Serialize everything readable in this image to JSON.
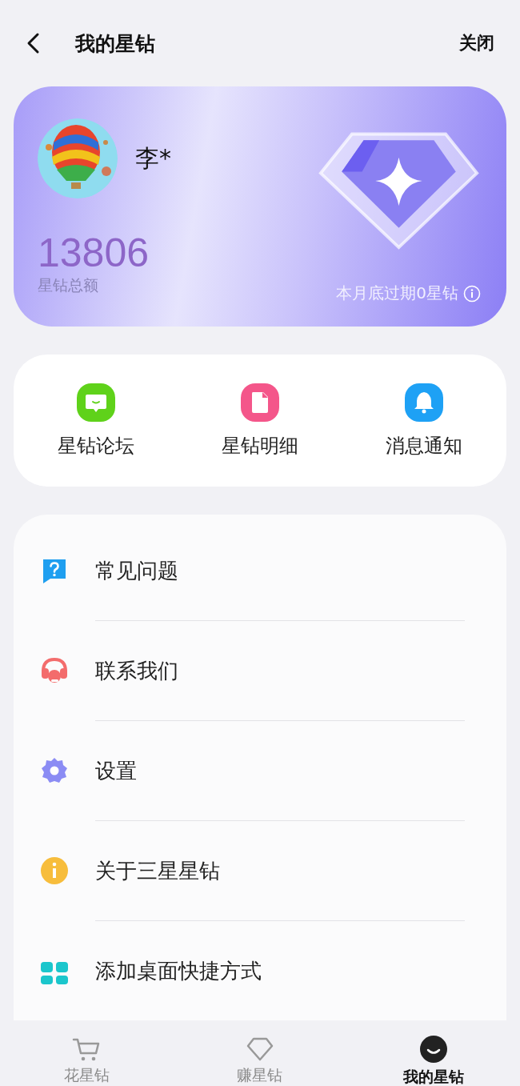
{
  "header": {
    "title": "我的星钻",
    "close": "关闭"
  },
  "balance_card": {
    "name": "李*",
    "amount": "13806",
    "amount_label": "星钻总额",
    "expiry_note": "本月底过期0星钻"
  },
  "quick_actions": [
    {
      "label": "星钻论坛",
      "kind": "forum",
      "color": "#5fd21a"
    },
    {
      "label": "星钻明细",
      "kind": "details",
      "color": "#f4568a"
    },
    {
      "label": "消息通知",
      "kind": "notice",
      "color": "#1ea1f5"
    }
  ],
  "menu": [
    {
      "label": "常见问题",
      "kind": "faq"
    },
    {
      "label": "联系我们",
      "kind": "contact"
    },
    {
      "label": "设置",
      "kind": "settings"
    },
    {
      "label": "关于三星星钻",
      "kind": "about"
    },
    {
      "label": "添加桌面快捷方式",
      "kind": "shortcut"
    }
  ],
  "bottom_nav": [
    {
      "label": "花星钻",
      "kind": "cart",
      "selected": false
    },
    {
      "label": "赚星钻",
      "kind": "diamond",
      "selected": false
    },
    {
      "label": "我的星钻",
      "kind": "me",
      "selected": true
    }
  ]
}
